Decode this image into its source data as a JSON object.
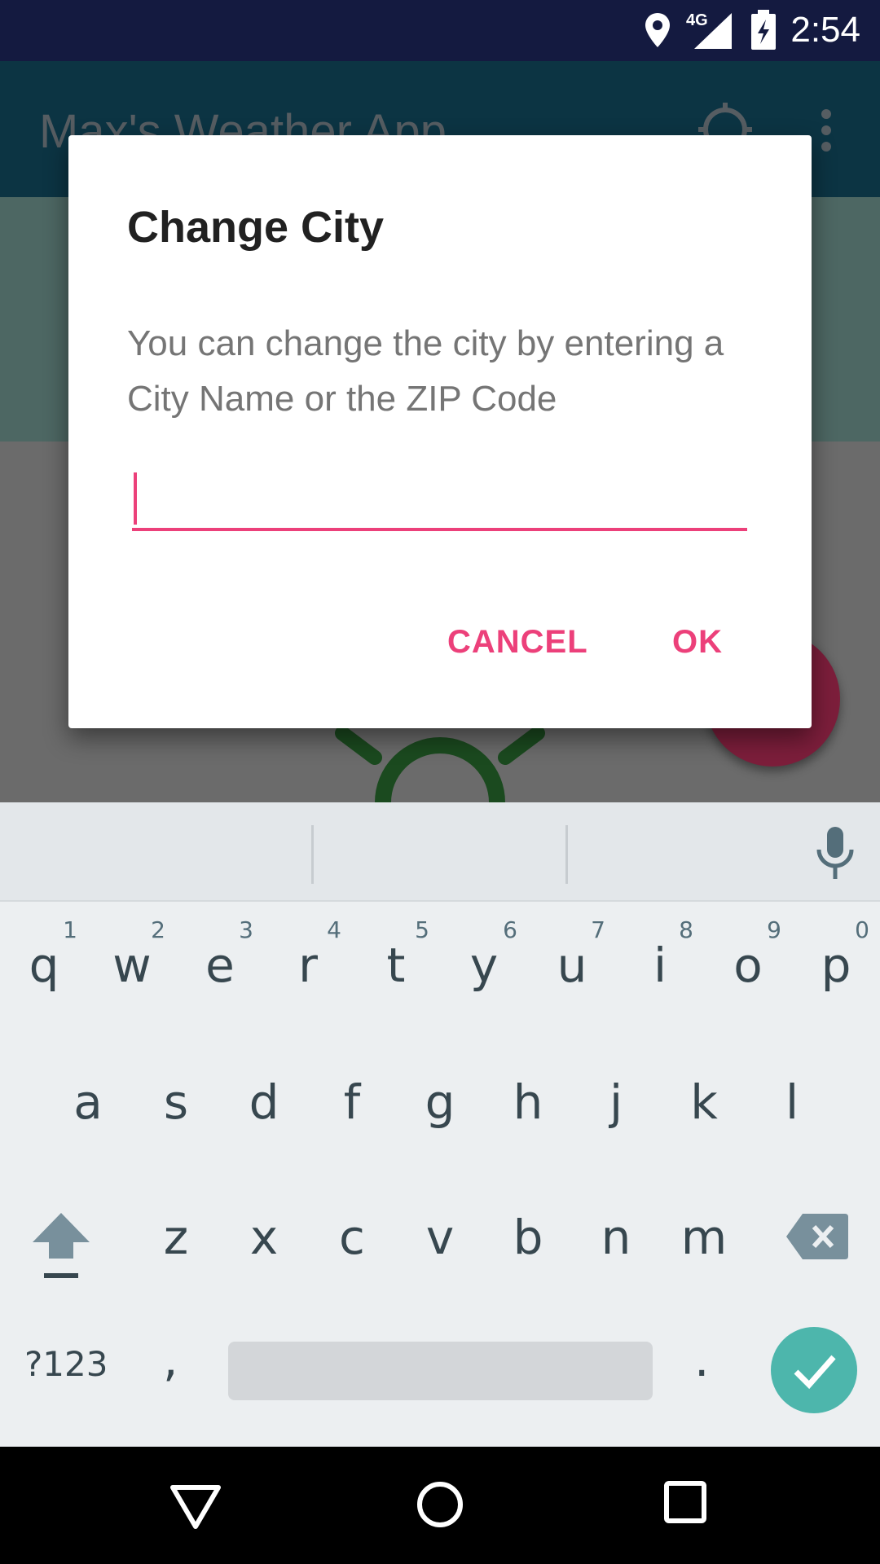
{
  "status_bar": {
    "time": "2:54",
    "network": "4G",
    "icons": [
      "location-icon",
      "signal-icon",
      "battery-charging-icon"
    ]
  },
  "app": {
    "title": "Max's Weather App",
    "icons": [
      "target-location-icon",
      "more-vert-icon",
      "weather-sun-icon"
    ],
    "colors": {
      "toolbar": "#0c3443",
      "fab": "#7c1e3b"
    }
  },
  "dialog": {
    "title": "Change City",
    "message": "You can change the city by entering a City Name or the ZIP Code",
    "input_value": "",
    "cancel_label": "CANCEL",
    "ok_label": "OK",
    "accent_color": "#ec407a"
  },
  "keyboard": {
    "row1": [
      {
        "key": "q",
        "hint": "1"
      },
      {
        "key": "w",
        "hint": "2"
      },
      {
        "key": "e",
        "hint": "3"
      },
      {
        "key": "r",
        "hint": "4"
      },
      {
        "key": "t",
        "hint": "5"
      },
      {
        "key": "y",
        "hint": "6"
      },
      {
        "key": "u",
        "hint": "7"
      },
      {
        "key": "i",
        "hint": "8"
      },
      {
        "key": "o",
        "hint": "9"
      },
      {
        "key": "p",
        "hint": "0"
      }
    ],
    "row2": [
      "a",
      "s",
      "d",
      "f",
      "g",
      "h",
      "j",
      "k",
      "l"
    ],
    "row3": [
      "z",
      "x",
      "c",
      "v",
      "b",
      "n",
      "m"
    ],
    "symbols_label": "?123",
    "comma": ",",
    "period": ".",
    "enter_color": "#4db6ac"
  },
  "nav_bar": {
    "icons": [
      "back-icon",
      "home-icon",
      "recents-icon"
    ]
  }
}
